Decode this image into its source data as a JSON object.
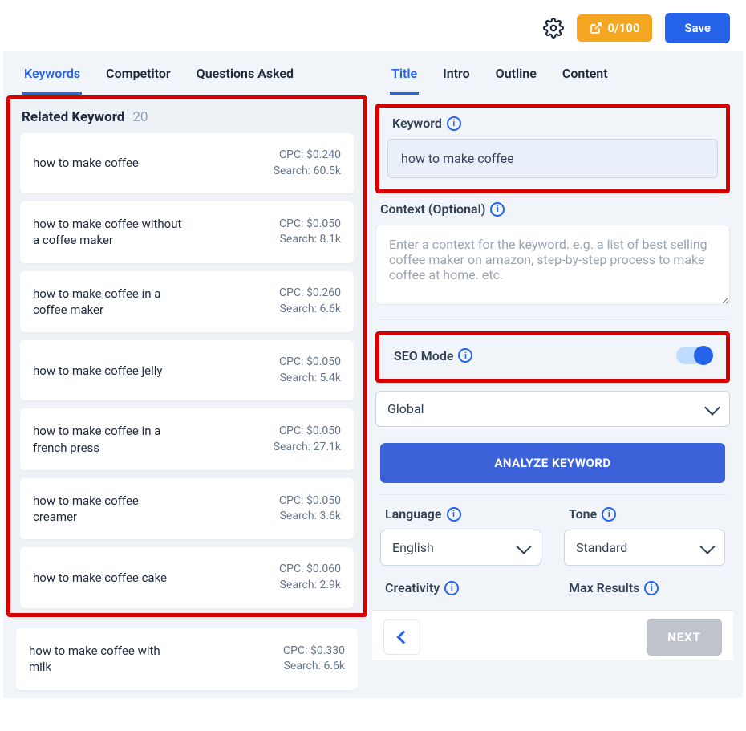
{
  "topbar": {
    "usage_label": "0/100",
    "save_label": "Save"
  },
  "left": {
    "tabs": [
      "Keywords",
      "Competitor",
      "Questions Asked"
    ],
    "active_tab": 0,
    "related_label": "Related Keyword",
    "related_count": "20",
    "keywords": [
      {
        "term": "how to make coffee",
        "cpc": "CPC: $0.240",
        "search": "Search: 60.5k"
      },
      {
        "term": "how to make coffee without a coffee maker",
        "cpc": "CPC: $0.050",
        "search": "Search: 8.1k"
      },
      {
        "term": "how to make coffee in a coffee maker",
        "cpc": "CPC: $0.260",
        "search": "Search: 6.6k"
      },
      {
        "term": "how to make coffee jelly",
        "cpc": "CPC: $0.050",
        "search": "Search: 5.4k"
      },
      {
        "term": "how to make coffee in a french press",
        "cpc": "CPC: $0.050",
        "search": "Search: 27.1k"
      },
      {
        "term": "how to make coffee creamer",
        "cpc": "CPC: $0.050",
        "search": "Search: 3.6k"
      },
      {
        "term": "how to make coffee cake",
        "cpc": "CPC: $0.060",
        "search": "Search: 2.9k"
      }
    ],
    "keywords_overflow": [
      {
        "term": "how to make coffee with milk",
        "cpc": "CPC: $0.330",
        "search": "Search: 6.6k"
      }
    ]
  },
  "right": {
    "tabs": [
      "Title",
      "Intro",
      "Outline",
      "Content"
    ],
    "active_tab": 0,
    "keyword_label": "Keyword",
    "keyword_value": "how to make coffee",
    "context_label": "Context (Optional)",
    "context_placeholder": "Enter a context for the keyword. e.g. a list of best selling coffee maker on amazon, step-by-step process to make coffee at home. etc.",
    "seo_label": "SEO Mode",
    "region_value": "Global",
    "analyze_label": "ANALYZE KEYWORD",
    "language_label": "Language",
    "language_value": "English",
    "tone_label": "Tone",
    "tone_value": "Standard",
    "creativity_label": "Creativity",
    "max_results_label": "Max Results",
    "next_label": "NEXT"
  }
}
